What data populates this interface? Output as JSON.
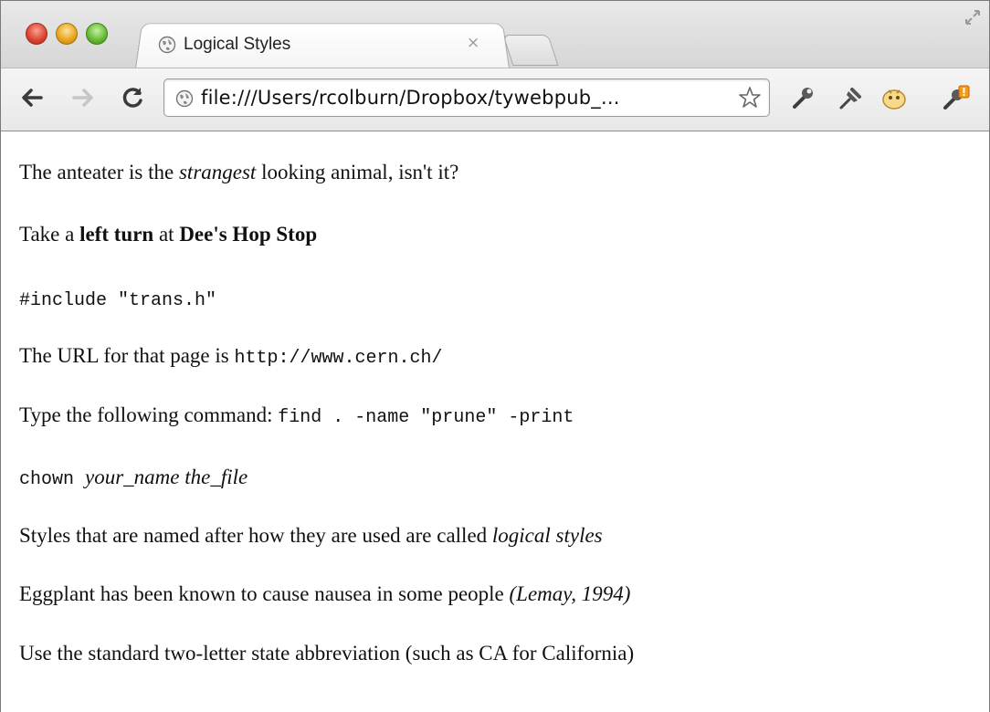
{
  "window": {
    "tab_title": "Logical Styles",
    "tab_close_label": "×",
    "url": "file:///Users/rcolburn/Dropbox/tywebpub_..."
  },
  "toolbar": {
    "icons": [
      "back-arrow-icon",
      "forward-arrow-icon",
      "reload-icon",
      "globe-icon",
      "star-icon",
      "wrench-icon",
      "pin-icon",
      "face-icon",
      "wrench-warning-icon"
    ]
  },
  "content": {
    "line1": {
      "before": "The anteater is the ",
      "em": "strangest",
      "after": " looking animal, isn't it?"
    },
    "line2": {
      "before": "Take a ",
      "strong1": "left turn",
      "mid": " at ",
      "strong2": "Dee's Hop Stop"
    },
    "line3": {
      "code": "#include \"trans.h\""
    },
    "line4": {
      "before": "The URL for that page is ",
      "code": "http://www.cern.ch/"
    },
    "line5": {
      "before": "Type the following command: ",
      "code": "find . -name \"prune\" -print"
    },
    "line6": {
      "code": "chown ",
      "var": "your_name the_file"
    },
    "line7": {
      "before": "Styles that are named after how they are used are called ",
      "dfn": "logical styles"
    },
    "line8": {
      "before": "Eggplant has been known to cause nausea in some people ",
      "cite": "(Lemay, 1994)"
    },
    "line9": {
      "text": "Use the standard two-letter state abbreviation (such as CA for California)"
    }
  }
}
